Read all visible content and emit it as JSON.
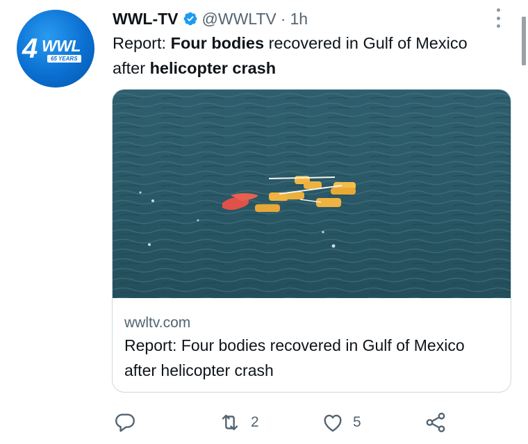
{
  "account": {
    "name": "WWL-TV",
    "handle": "@WWLTV",
    "separator": "·",
    "time": "1h",
    "avatar_logo": {
      "number": "4",
      "call_letters": "WWL",
      "tagline": "65 YEARS"
    }
  },
  "tweet": {
    "text_parts": [
      {
        "text": "Report: ",
        "bold": false
      },
      {
        "text": "Four bodies",
        "bold": true
      },
      {
        "text": " recovered in Gulf of Mexico after ",
        "bold": false
      },
      {
        "text": "helicopter crash",
        "bold": true
      }
    ]
  },
  "card": {
    "domain": "wwltv.com",
    "title": "Report: Four bodies recovered in Gulf of Mexico after helicopter crash",
    "image_description_icon": "ocean-photo"
  },
  "actions": {
    "reply": {
      "icon": "reply-icon",
      "count": ""
    },
    "retweet": {
      "icon": "retweet-icon",
      "count": "2"
    },
    "like": {
      "icon": "heart-icon",
      "count": "5"
    },
    "share": {
      "icon": "share-icon",
      "count": ""
    }
  },
  "colors": {
    "verified": "#1d9bf0",
    "secondary_text": "#536471",
    "avatar_blue": "#0a6fd1"
  }
}
